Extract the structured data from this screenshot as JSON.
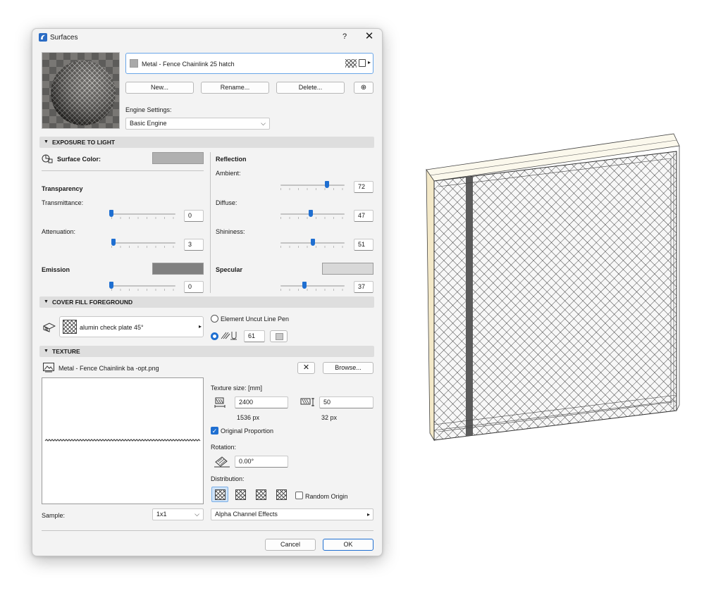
{
  "window": {
    "title": "Surfaces",
    "help": "?",
    "close": "✕"
  },
  "surface": {
    "name": "Metal - Fence Chainlink 25 hatch",
    "color": "#a9a9a9"
  },
  "buttons": {
    "new": "New...",
    "rename": "Rename...",
    "delete": "Delete...",
    "browse": "Browse...",
    "cancel": "Cancel",
    "ok": "OK"
  },
  "engine": {
    "label": "Engine Settings:",
    "value": "Basic Engine"
  },
  "exposure": {
    "header": "EXPOSURE TO LIGHT",
    "surface_color_label": "Surface Color:",
    "surface_color": "#b0b0b0",
    "transparency_label": "Transparency",
    "transmittance_label": "Transmittance:",
    "transmittance": "0",
    "transmittance_level": 0,
    "attenuation_label": "Attenuation:",
    "attenuation": "3",
    "attenuation_level": 0.03,
    "emission_label": "Emission",
    "emission_color": "#808080",
    "emission": "0",
    "emission_level": 0,
    "reflection_label": "Reflection",
    "ambient_label": "Ambient:",
    "ambient": "72",
    "ambient_level": 0.72,
    "diffuse_label": "Diffuse:",
    "diffuse": "47",
    "diffuse_level": 0.47,
    "shininess_label": "Shininess:",
    "shininess": "51",
    "shininess_level": 0.51,
    "specular_label": "Specular",
    "specular_color": "#d8d8d8",
    "specular": "37",
    "specular_level": 0.37
  },
  "cover_fill": {
    "header": "COVER FILL FOREGROUND",
    "fill_name": "alumin check plate 45°",
    "option_element_pen": "Element Uncut Line Pen",
    "pen_number": "61"
  },
  "texture": {
    "header": "TEXTURE",
    "file_name": "Metal - Fence Chainlink ba -opt.png",
    "size_label": "Texture size: [mm]",
    "width": "2400",
    "width_px": "1536 px",
    "height": "50",
    "height_px": "32 px",
    "original_proportion_label": "Original Proportion",
    "rotation_label": "Rotation:",
    "rotation": "0.00°",
    "distribution_label": "Distribution:",
    "random_origin_label": "Random Origin",
    "sample_label": "Sample:",
    "sample_value": "1x1",
    "alpha_label": "Alpha Channel Effects"
  }
}
